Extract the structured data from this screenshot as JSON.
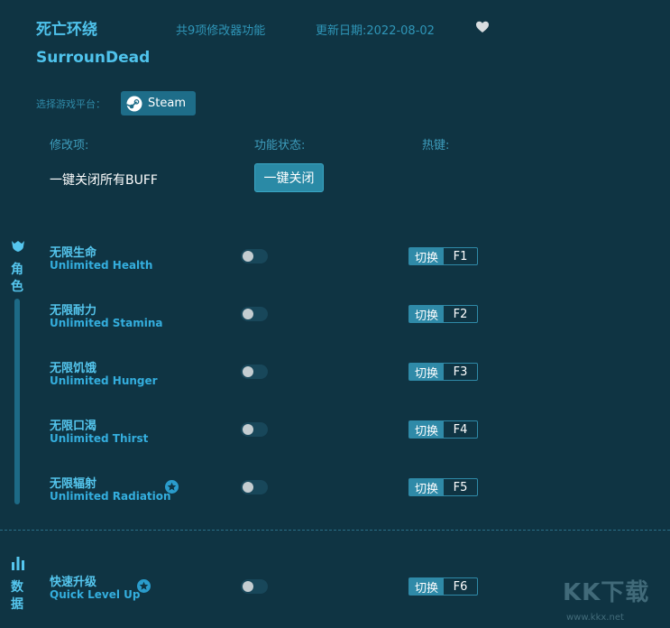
{
  "header": {
    "title_cn": "死亡环绕",
    "title_en": "SurrounDead",
    "feature_count": "共9项修改器功能",
    "update_date": "更新日期:2022-08-02",
    "favorite_icon": "heart-icon"
  },
  "platform": {
    "label": "选择游戏平台：",
    "button_label": "Steam",
    "icon": "steam-icon"
  },
  "columns": {
    "mod": "修改项:",
    "state": "功能状态:",
    "hotkey": "热键:"
  },
  "buff": {
    "label": "一键关闭所有BUFF",
    "button_label": "一键关闭"
  },
  "sections": [
    {
      "label": "角色",
      "icon": "character-icon"
    },
    {
      "label": "数据",
      "icon": "stats-icon"
    }
  ],
  "cheats": [
    {
      "cn": "无限生命",
      "en": "Unlimited Health",
      "switch": "切换",
      "key": "F1",
      "star": false
    },
    {
      "cn": "无限耐力",
      "en": "Unlimited Stamina",
      "switch": "切换",
      "key": "F2",
      "star": false
    },
    {
      "cn": "无限饥饿",
      "en": "Unlimited Hunger",
      "switch": "切换",
      "key": "F3",
      "star": false
    },
    {
      "cn": "无限口渴",
      "en": "Unlimited Thirst",
      "switch": "切换",
      "key": "F4",
      "star": false
    },
    {
      "cn": "无限辐射",
      "en": "Unlimited Radiation",
      "switch": "切换",
      "key": "F5",
      "star": true
    },
    {
      "cn": "快速升级",
      "en": "Quick Level Up",
      "switch": "切换",
      "key": "F6",
      "star": true
    }
  ],
  "watermark": {
    "text": "KK下载",
    "url": "www.kkx.net"
  },
  "colors": {
    "background": "#0f3443",
    "accent": "#4fc3ec",
    "button": "#2a8aa6"
  }
}
